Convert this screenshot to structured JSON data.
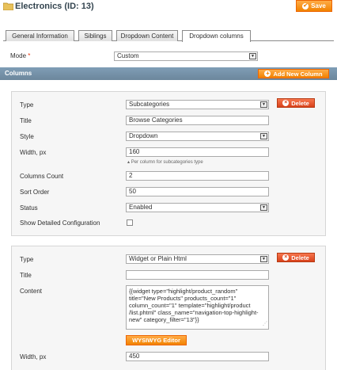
{
  "header": {
    "title": "Electronics (ID: 13)",
    "save_label": "Save"
  },
  "tabs": [
    {
      "label": "General Information"
    },
    {
      "label": "Siblings"
    },
    {
      "label": "Dropdown Content"
    },
    {
      "label": "Dropdown columns"
    }
  ],
  "mode": {
    "label": "Mode",
    "required_mark": "*",
    "value": "Custom"
  },
  "columns_section": {
    "title": "Columns",
    "add_label": "Add New Column"
  },
  "column1": {
    "type_label": "Type",
    "type_value": "Subcategories",
    "delete_label": "Delete",
    "title_label": "Title",
    "title_value": "Browse Categories",
    "style_label": "Style",
    "style_value": "Dropdown",
    "width_label": "Width, px",
    "width_value": "160",
    "width_note": "Per column for subcategories type",
    "columns_count_label": "Columns Count",
    "columns_count_value": "2",
    "sort_order_label": "Sort Order",
    "sort_order_value": "50",
    "status_label": "Status",
    "status_value": "Enabled",
    "detailed_label": "Show Detailed Configuration",
    "detailed_checked": false
  },
  "column2": {
    "type_label": "Type",
    "type_value": "Widget or Plain Html",
    "delete_label": "Delete",
    "title_label": "Title",
    "title_value": "",
    "content_label": "Content",
    "content_value": "{{widget type=\"highlight/product_random\" title=\"New Products\" products_count=\"1\" column_count=\"1\" template=\"highlight/product /list.phtml\" class_name=\"navigation-top-highlight-new\" category_filter=\"13\"}}",
    "wysiwyg_label": "WYSIWYG Editor",
    "width_label": "Width, px",
    "width_value": "450"
  }
}
